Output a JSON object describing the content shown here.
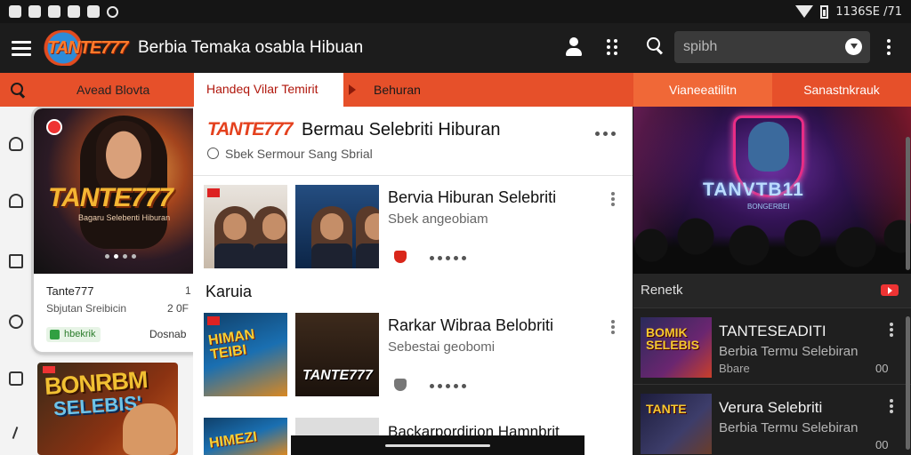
{
  "statusbar": {
    "time": "11:36 AM",
    "clock_text": "1136SE /71"
  },
  "appbar": {
    "logo_text": "TANTE777",
    "title": "Berbia Temaka osabla Hibuan",
    "search_placeholder": "spibh"
  },
  "tabs": {
    "search_label": "Avead Blovta",
    "active_label": "Handeq Vilar Temirit",
    "next_label": "Behuran",
    "right_tab_1": "Vianeeatilitn",
    "right_tab_2": "Sanastnkrauk"
  },
  "left": {
    "card1": {
      "brand": "TANTE777",
      "art_sub": "Bagaru Selebenti Hiburan",
      "title": "Tante777",
      "subtitle": "Sbjutan Sreibicin",
      "meta1": "1",
      "meta2": "2 0F",
      "badge": "hbekrik",
      "meta3": "Dosnab"
    },
    "card2": {
      "line1": "BONRBM",
      "line2": "SELEBIS'"
    }
  },
  "main": {
    "header": {
      "brand": "TANTE777",
      "title": "Bermau Selebriti Hiburan",
      "subtitle": "Sbek Sermour Sang Sbrial"
    },
    "items": [
      {
        "title": "Bervia Hiburan Selebriti",
        "subtitle": "Sbek angeobiam"
      },
      {
        "title": "Rarkar Wibraa Belobriti",
        "subtitle": "Sebestai geobomi",
        "poster_a": "HIMAN TEIBI",
        "poster_b": "TANTE777"
      }
    ],
    "section_label": "Karuia",
    "item3": {
      "title": "Backarpordirion Hamnbrit",
      "poster": "HIMEZI"
    }
  },
  "right": {
    "hero_text": "TANVTB11",
    "hero_sub": "BONGERBEI",
    "section_label": "Renetk",
    "items": [
      {
        "thumb_text": "BOMIK SELEBIS",
        "title": "TANTESEADITI",
        "subtitle": "Berbia Termu Selebiran",
        "sub2": "Bbare",
        "meta": "00"
      },
      {
        "thumb_text": "TANTE",
        "title": "Verura Selebriti",
        "subtitle": "Berbia Termu Selebiran",
        "sub2": "",
        "meta": "00"
      }
    ]
  },
  "colors": {
    "accent": "#e6502a",
    "brand_red": "#e4411e",
    "dark_bg": "#1c1c1c"
  }
}
